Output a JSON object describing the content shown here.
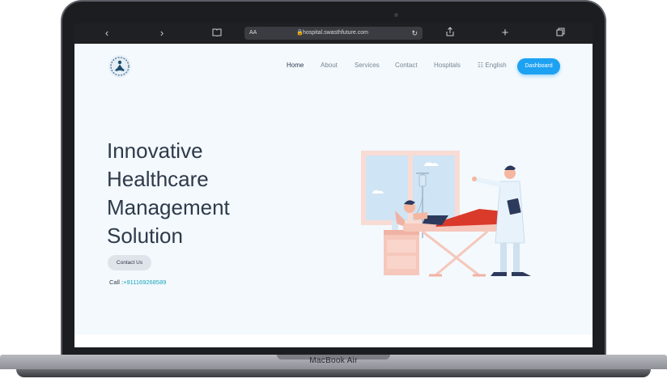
{
  "device": {
    "model_label": "MacBook Air"
  },
  "browser": {
    "url": "hospital.swasthfuture.com",
    "text_size_label": "AA",
    "icons": [
      "chevron-left-icon",
      "chevron-right-icon",
      "book-icon",
      "lock-icon",
      "reload-icon",
      "share-icon",
      "plus-icon",
      "tabs-icon"
    ]
  },
  "nav": {
    "logo": "meditation-logo-icon",
    "items": [
      "Home",
      "About",
      "Services",
      "Contact",
      "Hospitals"
    ],
    "active": "Home",
    "language": "English",
    "dashboard_label": "Dashboard"
  },
  "hero": {
    "title_lines": [
      "Innovative",
      "Healthcare",
      "Management",
      "Solution"
    ],
    "contact_button": "Contact Us",
    "call_label": "Call :",
    "phone": "+911169268589"
  },
  "colors": {
    "accent": "#1da1f2",
    "title": "#2e3a4a",
    "phone": "#1aa5b8",
    "page_bg": "#f3f9fd"
  }
}
